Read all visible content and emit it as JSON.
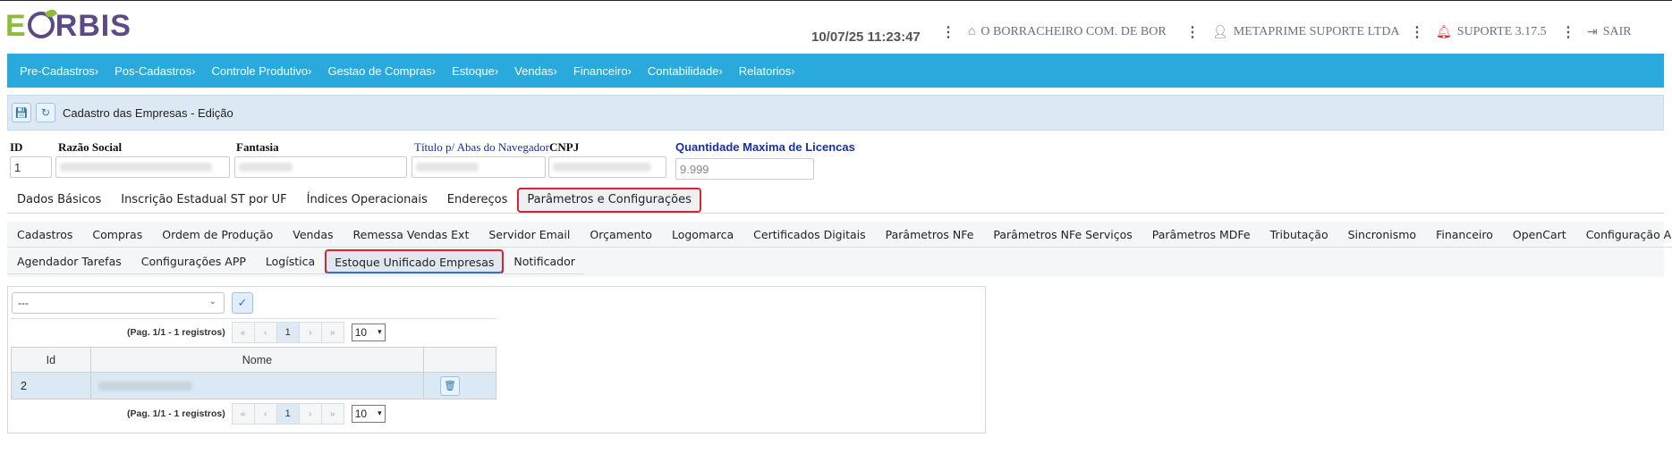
{
  "header": {
    "logo": {
      "e": "E",
      "rest": "BIS",
      "r": "R"
    },
    "datetime": "10/07/25 11:23:47",
    "company": "O BORRACHEIRO COM. DE BOR",
    "user": "METAPRIME SUPORTE LTDA",
    "version": "SUPORTE 3.17.5",
    "logout": "SAIR"
  },
  "nav": {
    "items": [
      "Pre-Cadastros›",
      "Pos-Cadastros›",
      "Controle Produtivo›",
      "Gestao de Compras›",
      "Estoque›",
      "Vendas›",
      "Financeiro›",
      "Contabilidade›",
      "Relatorios›"
    ]
  },
  "panel": {
    "title": "Cadastro das Empresas - Edição"
  },
  "fields": {
    "id_label": "ID",
    "id_value": "1",
    "razao_label": "Razão Social",
    "fantasia_label": "Fantasia",
    "titulo_label": "Título p/ Abas do Navegador",
    "cnpj_label": "CNPJ",
    "licencas_label": "Quantidade Maxima de Licencas",
    "licencas_value": "9.999"
  },
  "tabs_main": [
    "Dados Básicos",
    "Inscrição Estadual ST por UF",
    "Índices Operacionais",
    "Endereços",
    "Parâmetros e Configurações"
  ],
  "tabs_sub_row1": [
    "Cadastros",
    "Compras",
    "Ordem de Produção",
    "Vendas",
    "Remessa Vendas Ext",
    "Servidor Email",
    "Orçamento",
    "Logomarca",
    "Certificados Digitais",
    "Parâmetros NFe",
    "Parâmetros NFe Serviços",
    "Parâmetros MDFe",
    "Tributação",
    "Sincronismo",
    "Financeiro",
    "OpenCart",
    "Configuração API(s)"
  ],
  "tabs_sub_row2": [
    "Agendador Tarefas",
    "Configurações APP",
    "Logística",
    "Estoque Unificado Empresas",
    "Notificador"
  ],
  "selector": {
    "value": "---"
  },
  "pager": {
    "info": "(Pag. 1/1 - 1 registros)",
    "page": "1",
    "size": "10"
  },
  "table": {
    "columns": [
      "Id",
      "Nome"
    ],
    "rows": [
      {
        "id": "2"
      }
    ]
  },
  "colors": {
    "nav_bg": "#2aa9dc",
    "highlight": "#d7262e",
    "panel_bg": "#dce9f4"
  }
}
